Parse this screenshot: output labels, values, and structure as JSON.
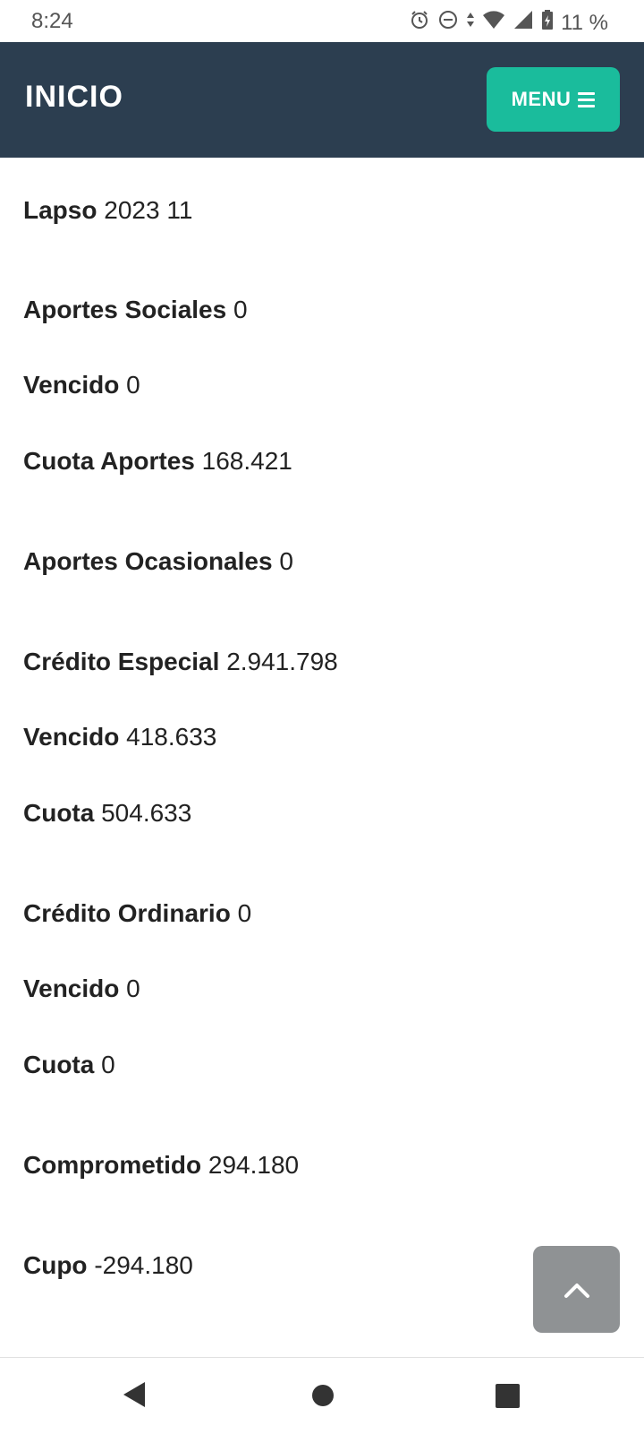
{
  "status_bar": {
    "time": "8:24",
    "battery": "11 %",
    "icons": [
      "alarm-icon",
      "dnd-icon",
      "data-arrows-icon",
      "wifi-icon",
      "signal-icon",
      "battery-icon"
    ]
  },
  "header": {
    "title": "INICIO",
    "menu_label": "MENU"
  },
  "rows": [
    {
      "label": "Lapso",
      "value": "2023 11"
    },
    {
      "label": "Aportes Sociales",
      "value": "0"
    },
    {
      "label": "Vencido",
      "value": "0"
    },
    {
      "label": "Cuota Aportes",
      "value": "168.421"
    },
    {
      "label": "Aportes Ocasionales",
      "value": "0"
    },
    {
      "label": "Crédito Especial",
      "value": "2.941.798"
    },
    {
      "label": "Vencido",
      "value": "418.633"
    },
    {
      "label": "Cuota",
      "value": "504.633"
    },
    {
      "label": "Crédito Ordinario",
      "value": "0"
    },
    {
      "label": "Vencido",
      "value": "0"
    },
    {
      "label": "Cuota",
      "value": "0"
    },
    {
      "label": "Comprometido",
      "value": "294.180"
    },
    {
      "label": "Cupo",
      "value": "-294.180"
    }
  ],
  "colors": {
    "header_bg": "#2c3e50",
    "menu_button_bg": "#1abc9c",
    "scroll_top_bg": "#8f9294"
  }
}
